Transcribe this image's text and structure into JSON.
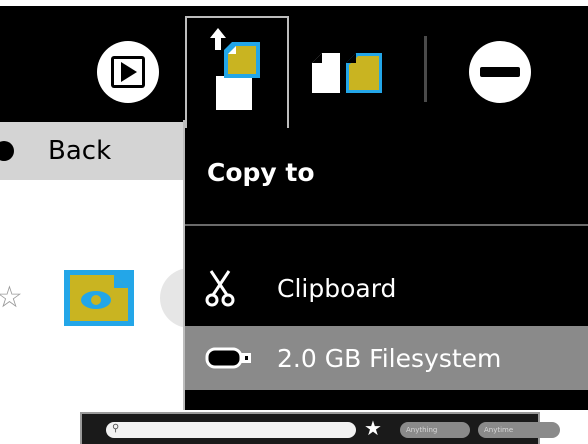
{
  "toolbar": {
    "buttons": [
      {
        "icon": "play-icon"
      },
      {
        "icon": "copy-to-icon"
      },
      {
        "icon": "duplicate-icon"
      },
      {
        "icon": "remove-icon"
      }
    ]
  },
  "journal": {
    "back_label": "Back"
  },
  "copy_menu": {
    "title": "Copy to",
    "items": [
      {
        "label": "Clipboard",
        "icon": "scissors-icon"
      },
      {
        "label": "2.0 GB Filesystem",
        "icon": "usb-drive-icon"
      }
    ]
  },
  "mini_toolbar": {
    "combo1": "Anything",
    "combo2": "Anytime"
  },
  "colors": {
    "toolbar_bg": "#000000",
    "highlight": "#8a8a8a",
    "doc_yellow": "#c9b421",
    "doc_blue": "#23a6e8"
  }
}
